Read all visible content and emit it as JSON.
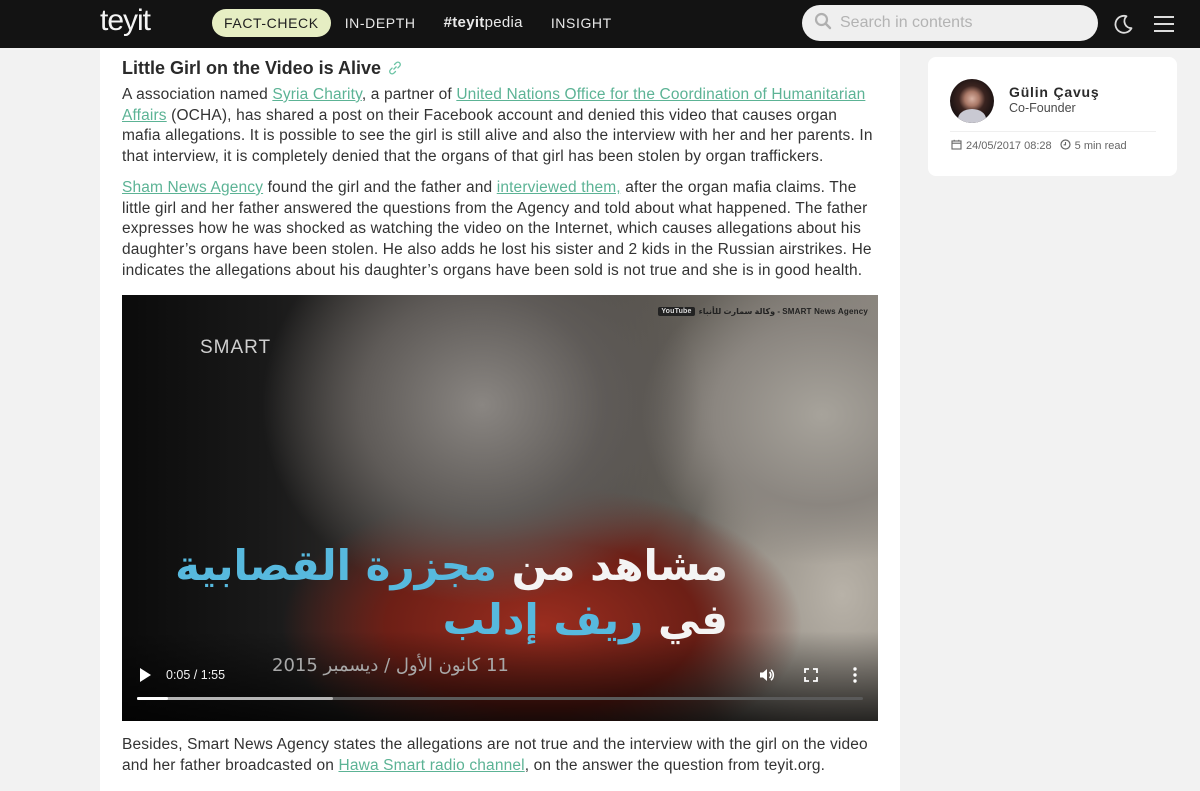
{
  "header": {
    "logo": "teyit",
    "nav": [
      {
        "label": "FACT-CHECK",
        "active": true
      },
      {
        "label": "IN-DEPTH",
        "active": false
      },
      {
        "label_hash": "#teyit",
        "label_rest": "pedia",
        "active": false
      },
      {
        "label": "INSIGHT",
        "active": false
      }
    ],
    "search_placeholder": "Search in contents",
    "icons": {
      "search": "search-icon",
      "theme": "moon-icon",
      "menu": "hamburger-menu-icon"
    }
  },
  "article": {
    "section_title": "Little Girl on the Video is Alive",
    "paragraph1": {
      "t1": "A association named ",
      "link1": "Syria Charity",
      "t2": ", a partner of ",
      "link2": "United Nations Office for the Coordination of Humanitarian Affairs",
      "t3": " (OCHA), has shared a post on their Facebook account and denied this video that causes organ mafia allegations. It is possible to see the girl is still alive and also the interview with her and her parents. In that interview, it is completely denied that the organs of that girl has been stolen by organ traffickers."
    },
    "paragraph2": {
      "link1": "Sham News Agency",
      "t1": " found the girl and the father and ",
      "link2": "interviewed them,",
      "t2": " after the organ mafia claims. The little girl and her father answered the questions from the Agency and told about what happened. The father expresses how he was shocked as watching the video on the Internet, which causes allegations about his daughter’s organs have been stolen. He also adds he lost his sister and 2 kids in the Russian airstrikes. He indicates the allegations about his daughter’s organs have been sold is not true and she is in good health."
    },
    "video": {
      "watermark": "وكالة سمارت للأنباء - SMART News Agency",
      "watermark_badge": "YouTube",
      "channel_logo": "SMART",
      "overlay_line1_white": "مشاهد من ",
      "overlay_line1_blue": "مجزرة القصابية",
      "overlay_line2_white": "في ",
      "overlay_line2_blue": "ريف إدلب",
      "overlay_date": "11 كانون الأول / ديسمبر 2015",
      "time_display": "0:05 / 1:55",
      "current_time": "0:05",
      "duration": "1:55",
      "played_fraction": 0.043,
      "buffered_fraction": 0.27
    },
    "paragraph3": {
      "t1": "Besides, Smart News Agency states the allegations are not true and the interview with the girl on the video and her father broadcasted on ",
      "link1": "Hawa Smart radio channel",
      "t2": ", on the answer the question from teyit.org."
    }
  },
  "author": {
    "name": "Gülin Çavuş",
    "role": "Co-Founder",
    "date": "24/05/2017 08:28",
    "read_time": "5 min read"
  },
  "colors": {
    "accent_link": "#5cb395",
    "nav_active_bg": "#e6eec3",
    "topbar_bg": "#131313"
  }
}
